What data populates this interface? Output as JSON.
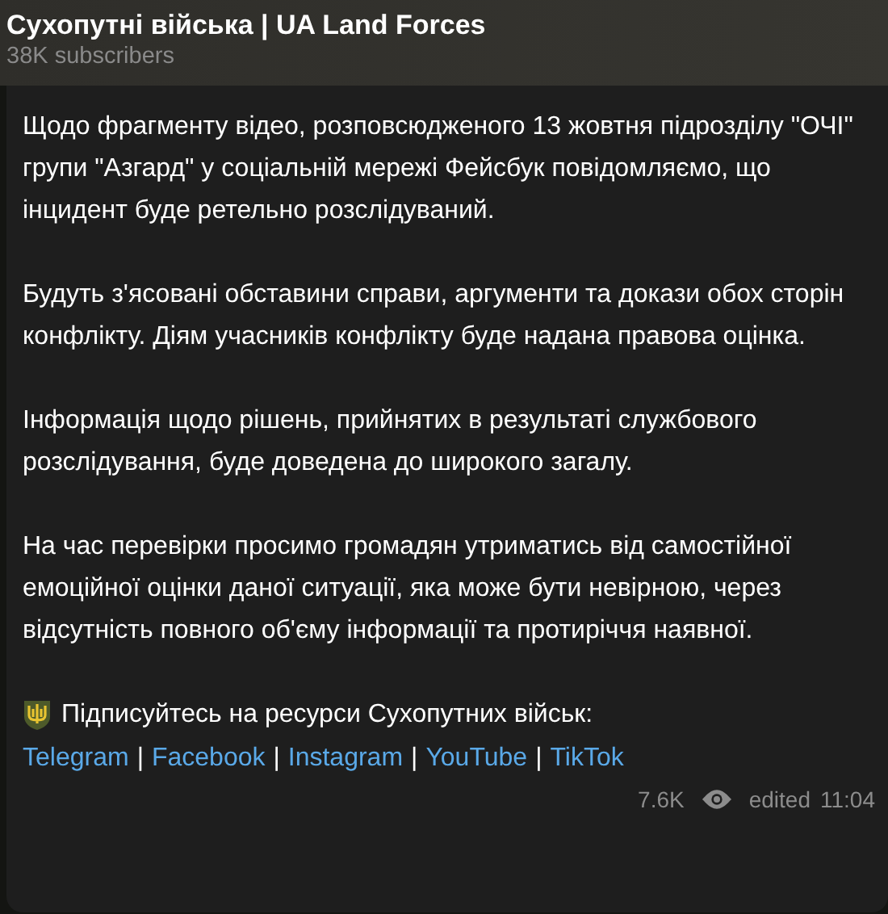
{
  "channel": {
    "title": "Сухопутні війська | UA Land Forces",
    "subscribers": "38K subscribers"
  },
  "post": {
    "paragraphs": [
      "Щодо фрагменту відео, розповсюдженого 13 жовтня підрозділу \"ОЧІ\" групи \"Азгард\" у соціальній мережі Фейсбук повідомляємо, що інцидент буде ретельно розслідуваний.",
      "Будуть з'ясовані обставини справи, аргументи та докази обох сторін конфлікту. Діям учасників конфлікту буде надана правова оцінка.",
      "Інформація щодо рішень, прийнятих в результаті службового розслідування, буде доведена до широкого загалу.",
      "На час перевірки просимо громадян утриматись від самостійної емоційної оцінки даної ситуації, яка може бути невірною, через відсутність повного об'єму інформації та протиріччя наявної."
    ],
    "subscribe_text": "Підписуйтесь на ресурси Сухопутних військ:",
    "links": [
      "Telegram",
      "Facebook",
      "Instagram",
      "YouTube",
      "TikTok"
    ],
    "separator": "|",
    "views": "7.6K",
    "edited": "edited",
    "time": "11:04"
  }
}
